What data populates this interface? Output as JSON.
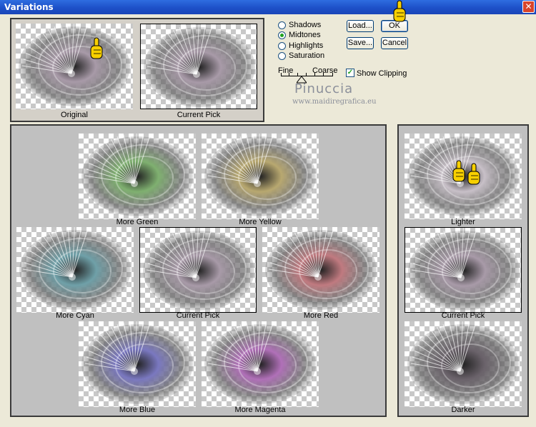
{
  "window": {
    "title": "Variations",
    "close_glyph": "✕"
  },
  "top_panel": {
    "original_caption": "Original",
    "current_pick_caption": "Current Pick"
  },
  "range": {
    "options": [
      "Shadows",
      "Midtones",
      "Highlights",
      "Saturation"
    ],
    "selected": "Midtones",
    "slider": {
      "fine_label": "Fine",
      "coarse_label": "Coarse",
      "value_fraction": 0.4
    }
  },
  "buttons": {
    "load": "Load...",
    "ok": "OK",
    "save": "Save...",
    "cancel": "Cancel"
  },
  "show_clipping": {
    "label": "Show Clipping",
    "checked": true
  },
  "watermark": {
    "name": "Pinuccia",
    "url": "www.maidiregrafica.eu"
  },
  "colors": {
    "green": "#7fb070",
    "yellow": "#b8a870",
    "cyan": "#6fa0a8",
    "current": "#a89aa8",
    "red": "#c07a80",
    "blue": "#7a78c0",
    "magenta": "#b070b8",
    "lighter": "#c8c0c8",
    "darker": "#6a626a",
    "original": "#a89aa8"
  },
  "variations": {
    "more_green": "More Green",
    "more_yellow": "More Yellow",
    "more_cyan": "More Cyan",
    "current_pick": "Current Pick",
    "more_red": "More Red",
    "more_blue": "More Blue",
    "more_magenta": "More Magenta"
  },
  "brightness": {
    "lighter": "Lighter",
    "current_pick": "Current Pick",
    "darker": "Darker"
  },
  "icons": [
    "pointing-hand-icon"
  ]
}
